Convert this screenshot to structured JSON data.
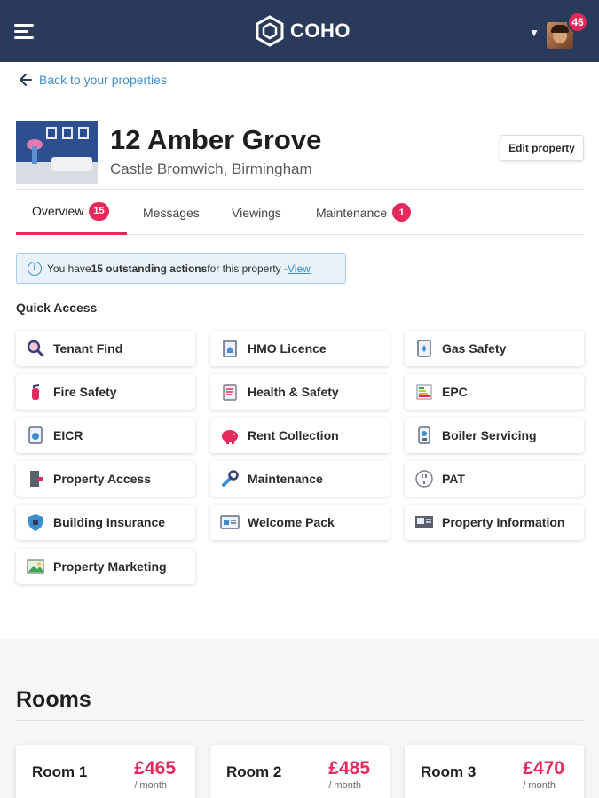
{
  "header": {
    "logo_text": "COHO",
    "notification_count": "46"
  },
  "nav": {
    "back_label": "Back to your properties"
  },
  "property": {
    "title": "12 Amber Grove",
    "subtitle": "Castle Bromwich, Birmingham",
    "edit_label": "Edit property"
  },
  "tabs": [
    {
      "label": "Overview",
      "badge": "15",
      "active": true
    },
    {
      "label": "Messages"
    },
    {
      "label": "Viewings"
    },
    {
      "label": "Maintenance",
      "badge": "1"
    }
  ],
  "notice": {
    "prefix": "You have ",
    "count_text": "15 outstanding actions",
    "suffix": " for this property - ",
    "link": "View"
  },
  "quick_access": {
    "heading": "Quick Access",
    "items": [
      {
        "label": "Tenant Find",
        "icon": "magnifier-icon"
      },
      {
        "label": "HMO Licence",
        "icon": "licence-building-icon"
      },
      {
        "label": "Gas Safety",
        "icon": "gas-flame-icon"
      },
      {
        "label": "Fire Safety",
        "icon": "fire-extinguisher-icon"
      },
      {
        "label": "Health & Safety",
        "icon": "clipboard-icon"
      },
      {
        "label": "EPC",
        "icon": "epc-chart-icon"
      },
      {
        "label": "EICR",
        "icon": "electrical-icon"
      },
      {
        "label": "Rent Collection",
        "icon": "piggy-bank-icon"
      },
      {
        "label": "Boiler Servicing",
        "icon": "boiler-icon"
      },
      {
        "label": "Property Access",
        "icon": "door-icon"
      },
      {
        "label": "Maintenance",
        "icon": "wrench-icon"
      },
      {
        "label": "PAT",
        "icon": "plug-icon"
      },
      {
        "label": "Building Insurance",
        "icon": "shield-icon"
      },
      {
        "label": "Welcome Pack",
        "icon": "welcome-pack-icon"
      },
      {
        "label": "Property Information",
        "icon": "property-info-icon"
      },
      {
        "label": "Property Marketing",
        "icon": "picture-icon"
      }
    ]
  },
  "rooms": {
    "heading": "Rooms",
    "items": [
      {
        "name": "Room 1",
        "price": "£465",
        "period": "/ month"
      },
      {
        "name": "Room 2",
        "price": "£485",
        "period": "/ month"
      },
      {
        "name": "Room 3",
        "price": "£470",
        "period": "/ month"
      }
    ]
  },
  "colors": {
    "header_bg": "#2a3a5a",
    "accent_pink": "#e6295b",
    "link_blue": "#3b8fd1"
  }
}
